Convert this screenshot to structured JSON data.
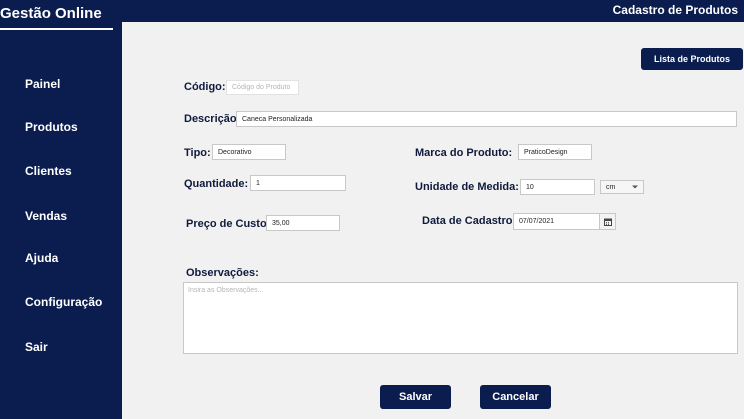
{
  "sidebar": {
    "brand": "Gestão Online",
    "items": [
      {
        "label": "Painel"
      },
      {
        "label": "Produtos"
      },
      {
        "label": "Clientes"
      },
      {
        "label": "Vendas"
      },
      {
        "label": "Ajuda"
      },
      {
        "label": "Configuração"
      },
      {
        "label": "Sair"
      }
    ]
  },
  "header": {
    "title": "Cadastro de Produtos"
  },
  "toolbar": {
    "list_button": "Lista de Produtos"
  },
  "form": {
    "codigo": {
      "label": "Código:",
      "placeholder": "Código do Produto"
    },
    "descricao": {
      "label": "Descrição:",
      "value": "Caneca Personalizada"
    },
    "tipo": {
      "label": "Tipo:",
      "value": "Decorativo"
    },
    "marca": {
      "label": "Marca do Produto:",
      "value": "PraticoDesign"
    },
    "quantidade": {
      "label": "Quantidade:",
      "value": "1"
    },
    "unidade": {
      "label": "Unidade de Medida:",
      "value": "10",
      "unit": "cm"
    },
    "preco": {
      "label": "Preço de Custo:",
      "value": "35,00"
    },
    "data": {
      "label": "Data de Cadastro:",
      "value": "07/07/2021"
    },
    "observacoes": {
      "label": "Observações:",
      "placeholder": "Insira as Observações..."
    }
  },
  "actions": {
    "save": "Salvar",
    "cancel": "Cancelar"
  },
  "colors": {
    "primary": "#0a1d4e",
    "background": "#f1f1f1"
  },
  "icons": {
    "date_picker": "calendar-icon",
    "unit_select": "chevron-down-icon"
  }
}
